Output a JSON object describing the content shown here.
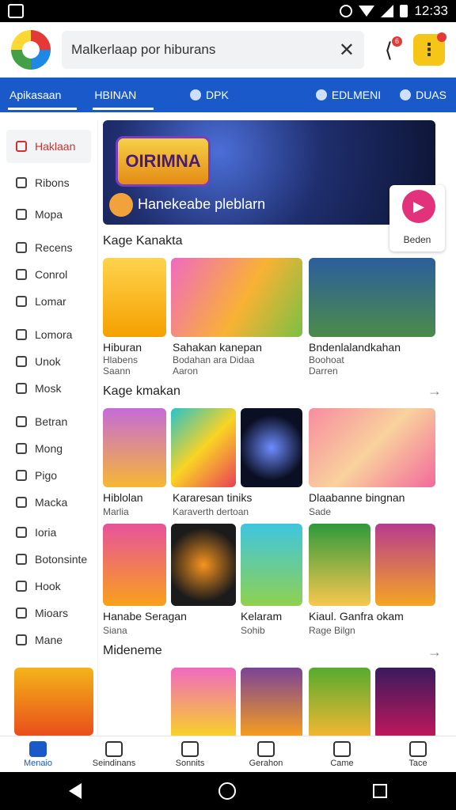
{
  "status_bar": {
    "time": "12:33"
  },
  "header": {
    "search_value": "Malkerlaap por hiburans",
    "clear_label": "✕",
    "share_badge": "6",
    "menu_label": "⋮"
  },
  "tabs": [
    {
      "label": "Apikasaan"
    },
    {
      "label": "HBINAN"
    },
    {
      "label": "DPK"
    },
    {
      "label": "EDLMENI"
    },
    {
      "label": "DUAS"
    }
  ],
  "sidebar": {
    "items": [
      {
        "label": "Haklaan"
      },
      {
        "label": "Ribons"
      },
      {
        "label": "Mopa"
      },
      {
        "label": "Recens"
      },
      {
        "label": "Conrol"
      },
      {
        "label": "Lomar"
      },
      {
        "label": "Lomora"
      },
      {
        "label": "Unok"
      },
      {
        "label": "Mosk"
      },
      {
        "label": "Betran"
      },
      {
        "label": "Mong"
      },
      {
        "label": "Pigo"
      },
      {
        "label": "Macka"
      },
      {
        "label": "Ioria"
      },
      {
        "label": "Botonsinte"
      },
      {
        "label": "Hook"
      },
      {
        "label": "Mioars"
      },
      {
        "label": "Mane"
      }
    ]
  },
  "banner": {
    "logo_text": "OIRIMNA",
    "title": "Hanekeabe pleblarn",
    "play_label": "Beden"
  },
  "sections": {
    "s1_title": "Kage Kanakta",
    "s2_title": "Kage kmakan",
    "s3_title": "Mideneme",
    "arrow": "→"
  },
  "row1": [
    {
      "title": "Hiburan",
      "sub1": "Hlabens",
      "sub2": "Saann"
    },
    {
      "title": "Sahakan kanepan",
      "sub1": "Bodahan ara Didaa",
      "sub2": "Aaron"
    },
    {
      "title": "Bndenlalandkahan",
      "sub1": "Boohoat",
      "sub2": "Darren"
    }
  ],
  "row2": [
    {
      "title": "Hiblolan",
      "sub1": "Marlia"
    },
    {
      "title": "Kararesan tiniks",
      "sub1": "Karaverth dertoan"
    },
    {
      "title": "Dlaabanne bingnan",
      "sub1": "Sade"
    }
  ],
  "row3": [
    {
      "title": "Hanabe Seragan",
      "sub1": "Siana"
    },
    {
      "title": "Kelaram",
      "sub1": "Sohib"
    },
    {
      "title": "Kiaul. Ganfra okam",
      "sub1": "Rage Bilgn"
    }
  ],
  "bottom_nav": [
    {
      "label": "Menaio"
    },
    {
      "label": "Seindinans"
    },
    {
      "label": "Sonnits"
    },
    {
      "label": "Gerahon"
    },
    {
      "label": "Came"
    },
    {
      "label": "Tace"
    }
  ],
  "colors": {
    "primary": "#1a59c9",
    "accent": "#d32f2f",
    "play": "#e3327c"
  }
}
